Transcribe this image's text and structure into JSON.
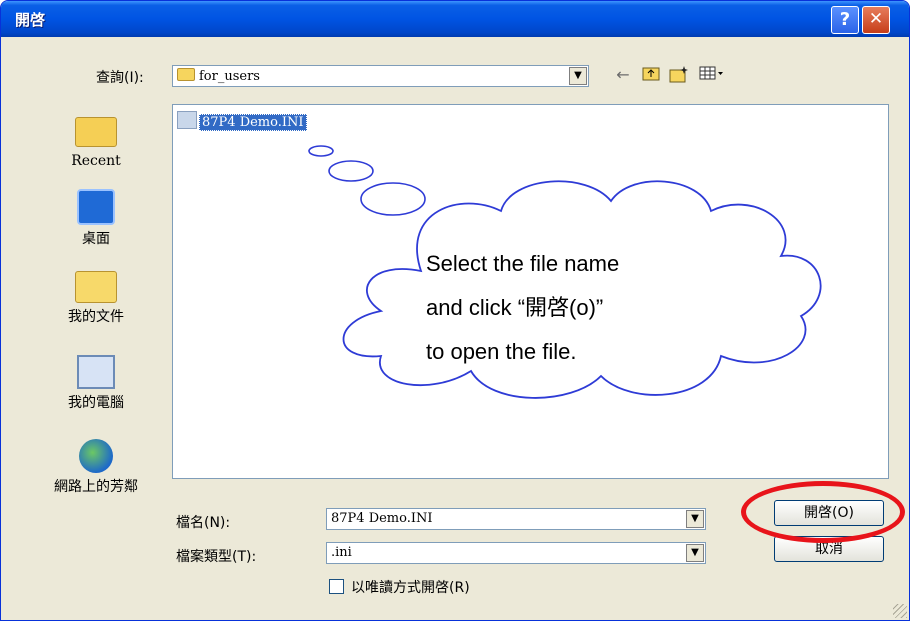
{
  "window": {
    "title": "開啓",
    "help_glyph": "?",
    "close_glyph": "✕"
  },
  "toolbar": {
    "look_in_label": "查詢(I):",
    "look_in_value": "for_users",
    "back_icon": "back-arrow-icon",
    "up_icon": "up-folder-icon",
    "new_folder_icon": "new-folder-icon",
    "view_icon": "view-menu-icon"
  },
  "places": [
    {
      "label": "Recent",
      "icon": "recent-folder-icon"
    },
    {
      "label": "桌面",
      "icon": "desktop-icon"
    },
    {
      "label": "我的文件",
      "icon": "my-documents-icon"
    },
    {
      "label": "我的電腦",
      "icon": "my-computer-icon"
    },
    {
      "label": "網路上的芳鄰",
      "icon": "network-places-icon"
    }
  ],
  "files": [
    {
      "name": "87P4 Demo.INI",
      "selected": true
    }
  ],
  "callout": {
    "line1": "Select the file name",
    "line2": "and  click  “開啓(o)”",
    "line3": "to open the file."
  },
  "form": {
    "filename_label": "檔名(N):",
    "filename_value": "87P4 Demo.INI",
    "filetype_label": "檔案類型(T):",
    "filetype_value": ".ini",
    "readonly_label": "以唯讀方式開啓(R)",
    "readonly_checked": false
  },
  "buttons": {
    "open_label": "開啓(O)",
    "cancel_label": "取消"
  },
  "colors": {
    "titlebar": "#0054e3",
    "selection": "#316ac5",
    "highlight_ellipse": "#e8141a"
  }
}
